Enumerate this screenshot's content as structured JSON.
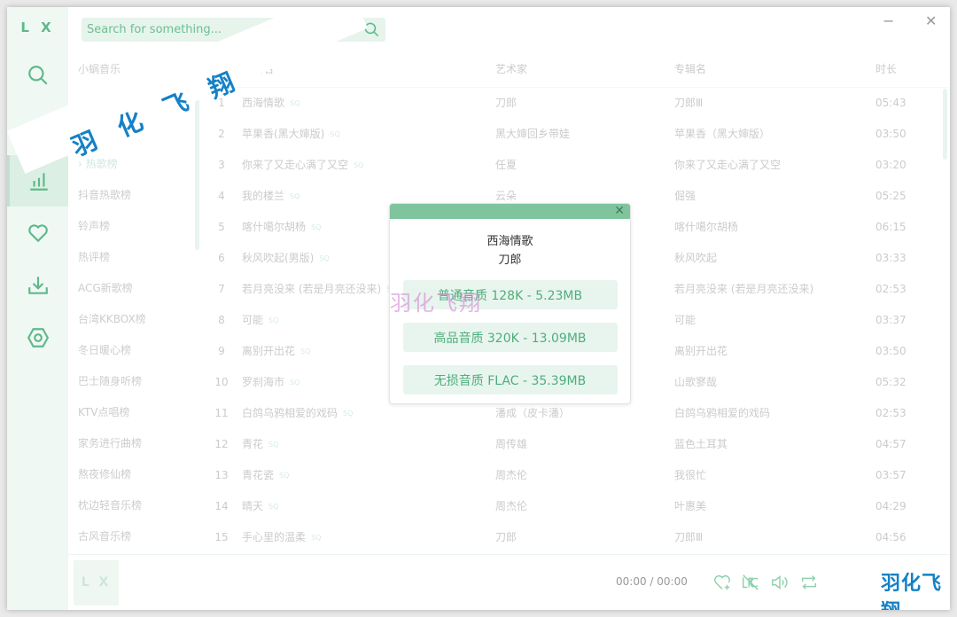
{
  "app": {
    "logo": "L X",
    "minimize": "−",
    "close": "✕"
  },
  "search": {
    "placeholder": "Search for something..."
  },
  "sidebar": {
    "items": [
      {
        "name": "search",
        "icon": "search-icon"
      },
      {
        "name": "leaderboard",
        "icon": "bar-chart-icon",
        "active": true
      },
      {
        "name": "favorites",
        "icon": "heart-icon"
      },
      {
        "name": "download",
        "icon": "download-icon"
      },
      {
        "name": "settings",
        "icon": "hexagon-settings-icon"
      }
    ]
  },
  "lists": {
    "source": "小蜗音乐",
    "items": [
      "新歌榜",
      "› 热歌榜",
      "抖音热歌榜",
      "铃声榜",
      "热评榜",
      "ACG新歌榜",
      "台湾KKBOX榜",
      "冬日暖心榜",
      "巴士随身听榜",
      "KTV点唱榜",
      "家务进行曲榜",
      "熬夜修仙榜",
      "枕边轻音乐榜",
      "古风音乐榜"
    ],
    "hidden_first": "",
    "active_index": 1
  },
  "table": {
    "headers": [
      "#",
      "歌曲名",
      "艺术家",
      "专辑名",
      "时长"
    ],
    "badge": "SQ",
    "rows": [
      [
        "1",
        "西海情歌",
        "刀郎",
        "刀郎Ⅲ",
        "05:43"
      ],
      [
        "2",
        "苹果香(黑大婶版)",
        "黑大婶回乡带娃",
        "苹果香（黑大婶版）",
        "03:50"
      ],
      [
        "3",
        "你来了又走心满了又空",
        "任夏",
        "你来了又走心满了又空",
        "03:20"
      ],
      [
        "4",
        "我的楼兰",
        "云朵",
        "倔强",
        "05:25"
      ],
      [
        "5",
        "喀什噶尔胡杨",
        "",
        "喀什噶尔胡杨",
        "06:15"
      ],
      [
        "6",
        "秋风吹起(男版)",
        "",
        "秋风吹起",
        "03:33"
      ],
      [
        "7",
        "若月亮没来 (若是月亮还没来)",
        "",
        "若月亮没来 (若是月亮还没来)",
        "02:53"
      ],
      [
        "8",
        "可能",
        "",
        "可能",
        "03:37"
      ],
      [
        "9",
        "离别开出花",
        "",
        "离别开出花",
        "03:50"
      ],
      [
        "10",
        "罗刹海市",
        "",
        "山歌寥哉",
        "05:32"
      ],
      [
        "11",
        "白鸽乌鸦相爱的戏码",
        "潘成（皮卡潘）",
        "白鸽乌鸦相爱的戏码",
        "02:53"
      ],
      [
        "12",
        "青花",
        "周传雄",
        "蓝色土耳其",
        "04:57"
      ],
      [
        "13",
        "青花瓷",
        "周杰伦",
        "我很忙",
        "03:57"
      ],
      [
        "14",
        "晴天",
        "周杰伦",
        "叶惠美",
        "04:29"
      ],
      [
        "15",
        "手心里的温柔",
        "刀郎",
        "刀郎Ⅲ",
        "04:56"
      ]
    ]
  },
  "player": {
    "cover_logo": "L X",
    "time": "00:00 / 00:00",
    "controls": [
      "heart-add-icon",
      "lyrics-off-icon",
      "volume-icon",
      "repeat-icon"
    ]
  },
  "dialog": {
    "title": "西海情歌",
    "artist": "刀郎",
    "close": "✕",
    "options": [
      "普通音质 128K - 5.23MB",
      "高品音质 320K - 13.09MB",
      "无损音质 FLAC - 35.39MB"
    ]
  },
  "watermark": {
    "text": "羽化飞翔"
  },
  "colors": {
    "accent": "#5fb98a",
    "dialog_header": "#7ec59e",
    "sidebar_bg": "#f0f8f4",
    "watermark_blue": "#1481c6"
  }
}
